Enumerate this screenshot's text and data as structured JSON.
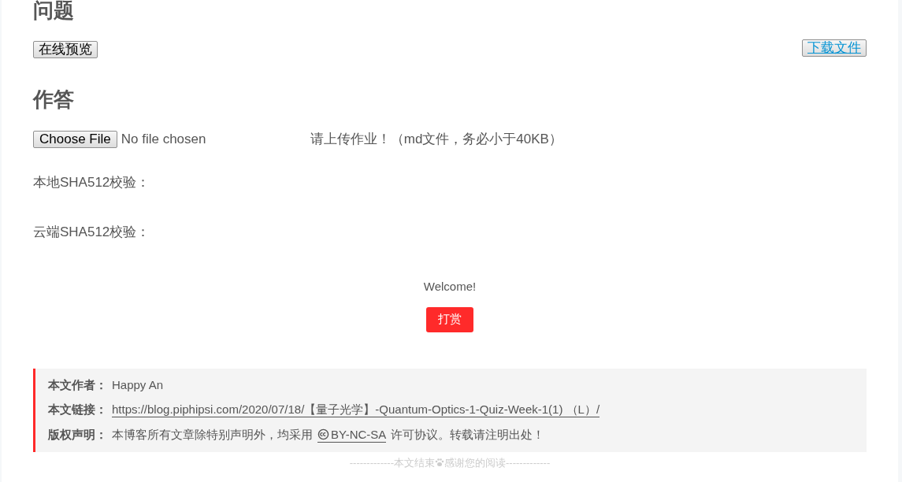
{
  "question": {
    "heading": "问题",
    "preview_button": "在线预览",
    "download_button": "下载文件"
  },
  "answer": {
    "heading": "作答",
    "file_button": "Choose File",
    "file_status": "No file chosen",
    "upload_hint": "请上传作业！（md文件，务必小于40KB）",
    "local_check": "本地SHA512校验：",
    "cloud_check": "云端SHA512校验："
  },
  "reward": {
    "welcome": "Welcome!",
    "button": "打赏"
  },
  "copyright": {
    "author_label": "本文作者：",
    "author": "Happy An",
    "link_label": "本文链接：",
    "link": "https://blog.piphipsi.com/2020/07/18/【量子光学】-Quantum-Optics-1-Quiz-Week-1(1) （L）/",
    "license_label": "版权声明：",
    "license_before": "本博客所有文章除特别声明外，均采用",
    "license_link": "BY-NC-SA",
    "license_after": "许可协议。转载请注明出处！"
  },
  "end_note": {
    "before": "-------------本文结束",
    "after": "感谢您的阅读-------------"
  }
}
